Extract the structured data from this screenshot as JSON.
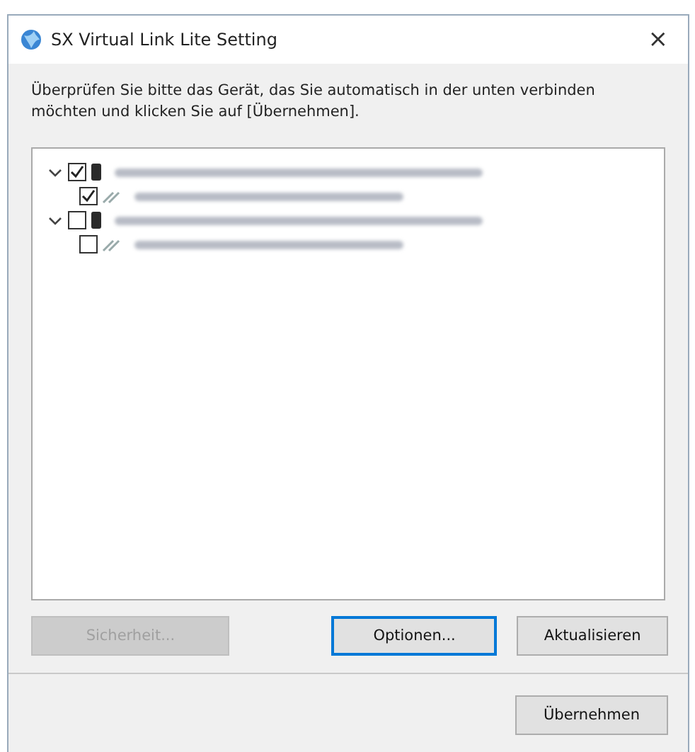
{
  "window": {
    "title": "SX Virtual Link Lite Setting",
    "close": "×"
  },
  "instruction": "Überprüfen Sie bitte das Gerät, das Sie automatisch in der unten verbinden möchten und klicken Sie auf [Übernehmen].",
  "tree": [
    {
      "kind": "device",
      "checked": true,
      "expanded": true,
      "children": [
        {
          "kind": "token",
          "checked": true
        }
      ]
    },
    {
      "kind": "device",
      "checked": false,
      "expanded": true,
      "children": [
        {
          "kind": "token",
          "checked": false
        }
      ]
    }
  ],
  "buttons": [
    {
      "label": "Sicherheit...",
      "disabled": true,
      "focused": false
    },
    {
      "label": "Optionen...",
      "disabled": false,
      "focused": true
    },
    {
      "label": "Aktualisieren",
      "disabled": false,
      "focused": false
    }
  ],
  "apply_button": {
    "label": "Übernehmen",
    "disabled": false,
    "focused": false
  }
}
